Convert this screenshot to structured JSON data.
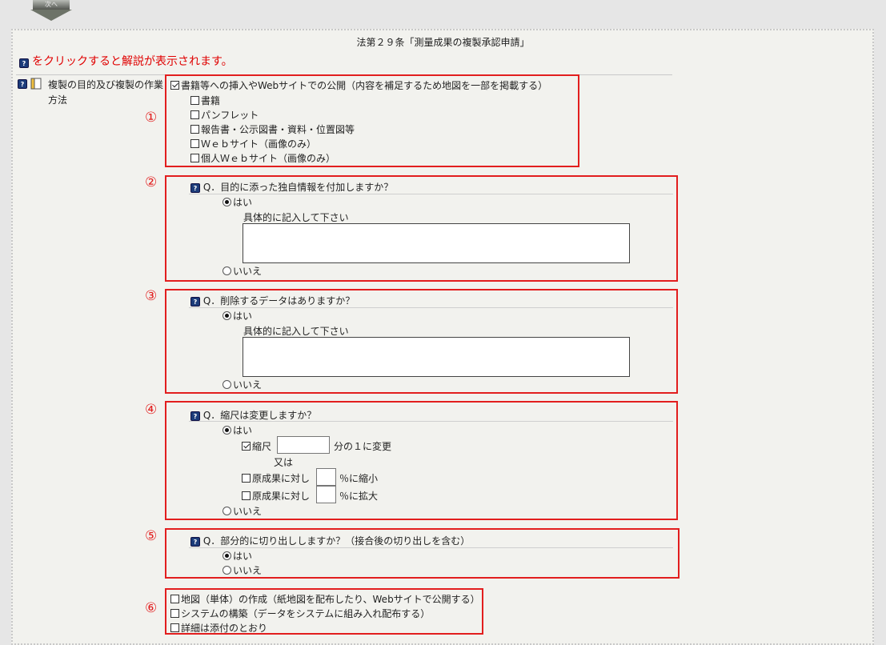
{
  "header": {
    "next_button": "次へ",
    "form_title": "法第２９条「測量成果の複製承認申請」"
  },
  "notice": "をクリックすると解説が表示されます。",
  "field_label": "複製の目的及び複製の作業方法",
  "section1": {
    "number": "①",
    "main_option": "書籍等への挿入やWebサイトでの公開（内容を補足するため地図を一部を掲載する）",
    "sub_options": [
      "書籍",
      "パンフレット",
      "報告書・公示図書・資料・位置図等",
      "Ｗｅｂサイト（画像のみ）",
      "個人Ｗｅｂサイト（画像のみ）"
    ]
  },
  "section2": {
    "number": "②",
    "question": "Q．目的に添った独自情報を付加しますか？",
    "yes": "はい",
    "detail_label": "具体的に記入して下さい",
    "textarea_value": "",
    "no": "いいえ"
  },
  "section3": {
    "number": "③",
    "question": "Q．削除するデータはありますか？",
    "yes": "はい",
    "detail_label": "具体的に記入して下さい",
    "textarea_value": "",
    "no": "いいえ"
  },
  "section4": {
    "number": "④",
    "question": "Q．縮尺は変更しますか？",
    "yes": "はい",
    "scale_label": "縮尺",
    "scale_value": "",
    "scale_suffix": "分の１に変更",
    "or": "又は",
    "reduce_label": "原成果に対し",
    "reduce_value": "",
    "reduce_suffix": "％に縮小",
    "enlarge_label": "原成果に対し",
    "enlarge_value": "",
    "enlarge_suffix": "％に拡大",
    "no": "いいえ"
  },
  "section5": {
    "number": "⑤",
    "question": "Q．部分的に切り出ししますか？（接合後の切り出しを含む）",
    "yes": "はい",
    "no": "いいえ"
  },
  "section6": {
    "number": "⑥",
    "options": [
      "地図（単体）の作成（紙地図を配布したり、Webサイトで公開する）",
      "システムの構築（データをシステムに組み入れ配布する）",
      "詳細は添付のとおり"
    ]
  },
  "colors": {
    "red": "#e21e1e",
    "notice": "#e00000",
    "background": "#e6e6e6",
    "panel": "#f2f2ee"
  }
}
